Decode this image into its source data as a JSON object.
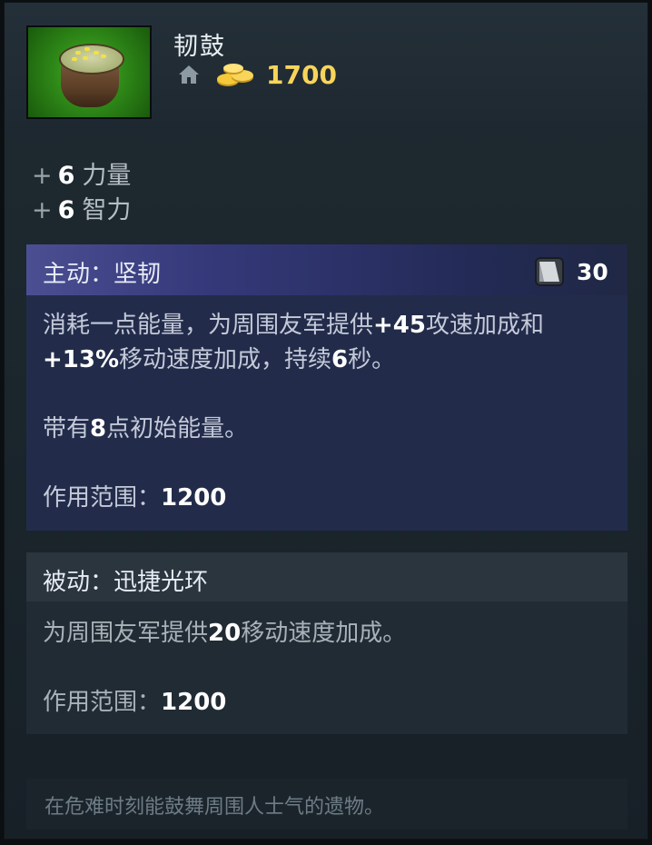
{
  "item": {
    "name": "韧鼓",
    "cost": "1700",
    "icon_semantic": "drum-item-icon",
    "shop_icon": "home-icon",
    "gold_icon": "gold-coins-icon"
  },
  "stats": [
    {
      "plus": "+",
      "value": "6",
      "label": "力量"
    },
    {
      "plus": "+",
      "value": "6",
      "label": "智力"
    }
  ],
  "active": {
    "title": "主动：坚韧",
    "cooldown": "30",
    "line1": {
      "a": "消耗一点能量，为周围友军提供",
      "b": "+45",
      "c": "攻速加成和"
    },
    "line2": {
      "a": "+13%",
      "b": "移动速度加成，持续",
      "c": "6",
      "d": "秒。"
    },
    "line3": {
      "a": "带有",
      "b": "8",
      "c": "点初始能量。"
    },
    "range_label": "作用范围：",
    "range_value": "1200"
  },
  "passive": {
    "title": "被动：迅捷光环",
    "line1": {
      "a": "为周围友军提供",
      "b": "20",
      "c": "移动速度加成。"
    },
    "range_label": "作用范围：",
    "range_value": "1200"
  },
  "lore": "在危难时刻能鼓舞周围人士气的遗物。",
  "colors": {
    "gold": "#f7d55a",
    "active_header": "#4b4f92",
    "background": "#1f2a31"
  }
}
